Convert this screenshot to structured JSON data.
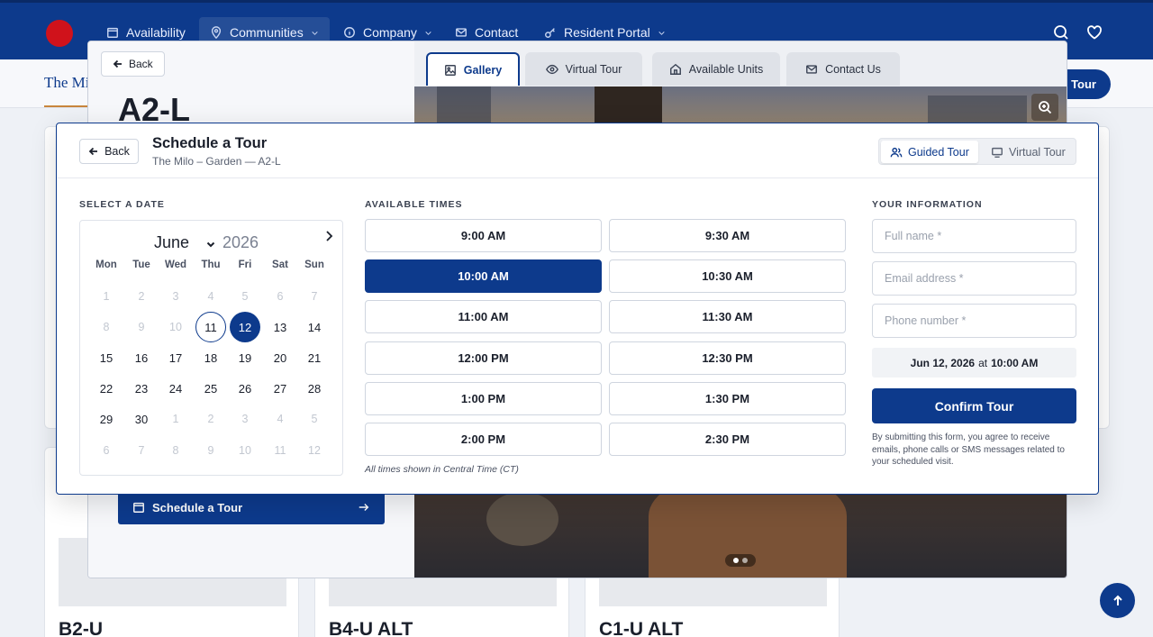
{
  "nav": {
    "items": [
      {
        "label": "Availability",
        "icon": "calendar-icon"
      },
      {
        "label": "Communities",
        "icon": "map-pin-icon"
      },
      {
        "label": "Company",
        "icon": "info-icon"
      },
      {
        "label": "Contact",
        "icon": "mail-icon"
      },
      {
        "label": "Resident Portal",
        "icon": "key-icon"
      }
    ]
  },
  "subbar": {
    "brand": "The Mil",
    "tour_button": "Tour"
  },
  "background_cards": [
    "B2-U",
    "B4-U ALT",
    "C1-U ALT"
  ],
  "unit_modal": {
    "back_label": "Back",
    "unit_name": "A2-L",
    "tabs": [
      "Gallery",
      "Virtual Tour",
      "Available Units",
      "Contact Us"
    ],
    "schedule_button": "Schedule a Tour"
  },
  "schedule": {
    "back_label": "Back",
    "title": "Schedule a Tour",
    "subtitle": "The Milo – Garden — A2-L",
    "modes": [
      "Guided Tour",
      "Virtual Tour"
    ],
    "date_label": "SELECT A DATE",
    "times_label": "AVAILABLE TIMES",
    "info_label": "YOUR INFORMATION",
    "calendar": {
      "month": "June",
      "year": "2026",
      "weekdays": [
        "Mon",
        "Tue",
        "Wed",
        "Thu",
        "Fri",
        "Sat",
        "Sun"
      ],
      "weeks": [
        [
          "1",
          "2",
          "3",
          "4",
          "5",
          "6",
          "7"
        ],
        [
          "8",
          "9",
          "10",
          "11",
          "12",
          "13",
          "14"
        ],
        [
          "15",
          "16",
          "17",
          "18",
          "19",
          "20",
          "21"
        ],
        [
          "22",
          "23",
          "24",
          "25",
          "26",
          "27",
          "28"
        ],
        [
          "29",
          "30",
          "1",
          "2",
          "3",
          "4",
          "5"
        ],
        [
          "6",
          "7",
          "8",
          "9",
          "10",
          "11",
          "12"
        ]
      ]
    },
    "times": [
      "9:00 AM",
      "9:30 AM",
      "10:00 AM",
      "10:30 AM",
      "11:00 AM",
      "11:30 AM",
      "12:00 PM",
      "12:30 PM",
      "1:00 PM",
      "1:30 PM",
      "2:00 PM",
      "2:30 PM"
    ],
    "selected_time": "10:00 AM",
    "timezone_note": "All times shown in Central Time (CT)",
    "form": {
      "name_placeholder": "Full name *",
      "email_placeholder": "Email address *",
      "phone_placeholder": "Phone number *"
    },
    "summary": {
      "date": "Jun 12, 2026",
      "at": "at",
      "time": "10:00 AM"
    },
    "confirm_label": "Confirm Tour",
    "disclaimer": "By submitting this form, you agree to receive emails, phone calls or SMS messages related to your scheduled visit."
  },
  "colors": {
    "primary": "#0d3a8c",
    "logo": "#d0121b"
  }
}
